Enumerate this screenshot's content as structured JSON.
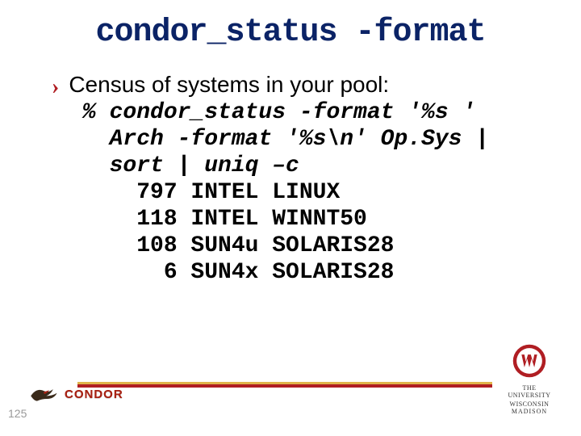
{
  "title": "condor_status -format",
  "bullet": "Census of systems in your pool:",
  "command": {
    "l1": "% condor_status -format '%s '",
    "l2": "  Arch -format '%s\\n' Op.Sys |",
    "l3": "  sort | uniq –c"
  },
  "output": {
    "l1": "    797 INTEL LINUX",
    "l2": "    118 INTEL WINNT50",
    "l3": "    108 SUN4u SOLARIS28",
    "l4": "      6 SUN4x SOLARIS28"
  },
  "footer": {
    "pagenum": "125",
    "condor_brand": "CONDOR",
    "uw_line1": "THE UNIVERSITY",
    "uw_line2": "WISCONSIN",
    "uw_sub": "MADISON"
  }
}
